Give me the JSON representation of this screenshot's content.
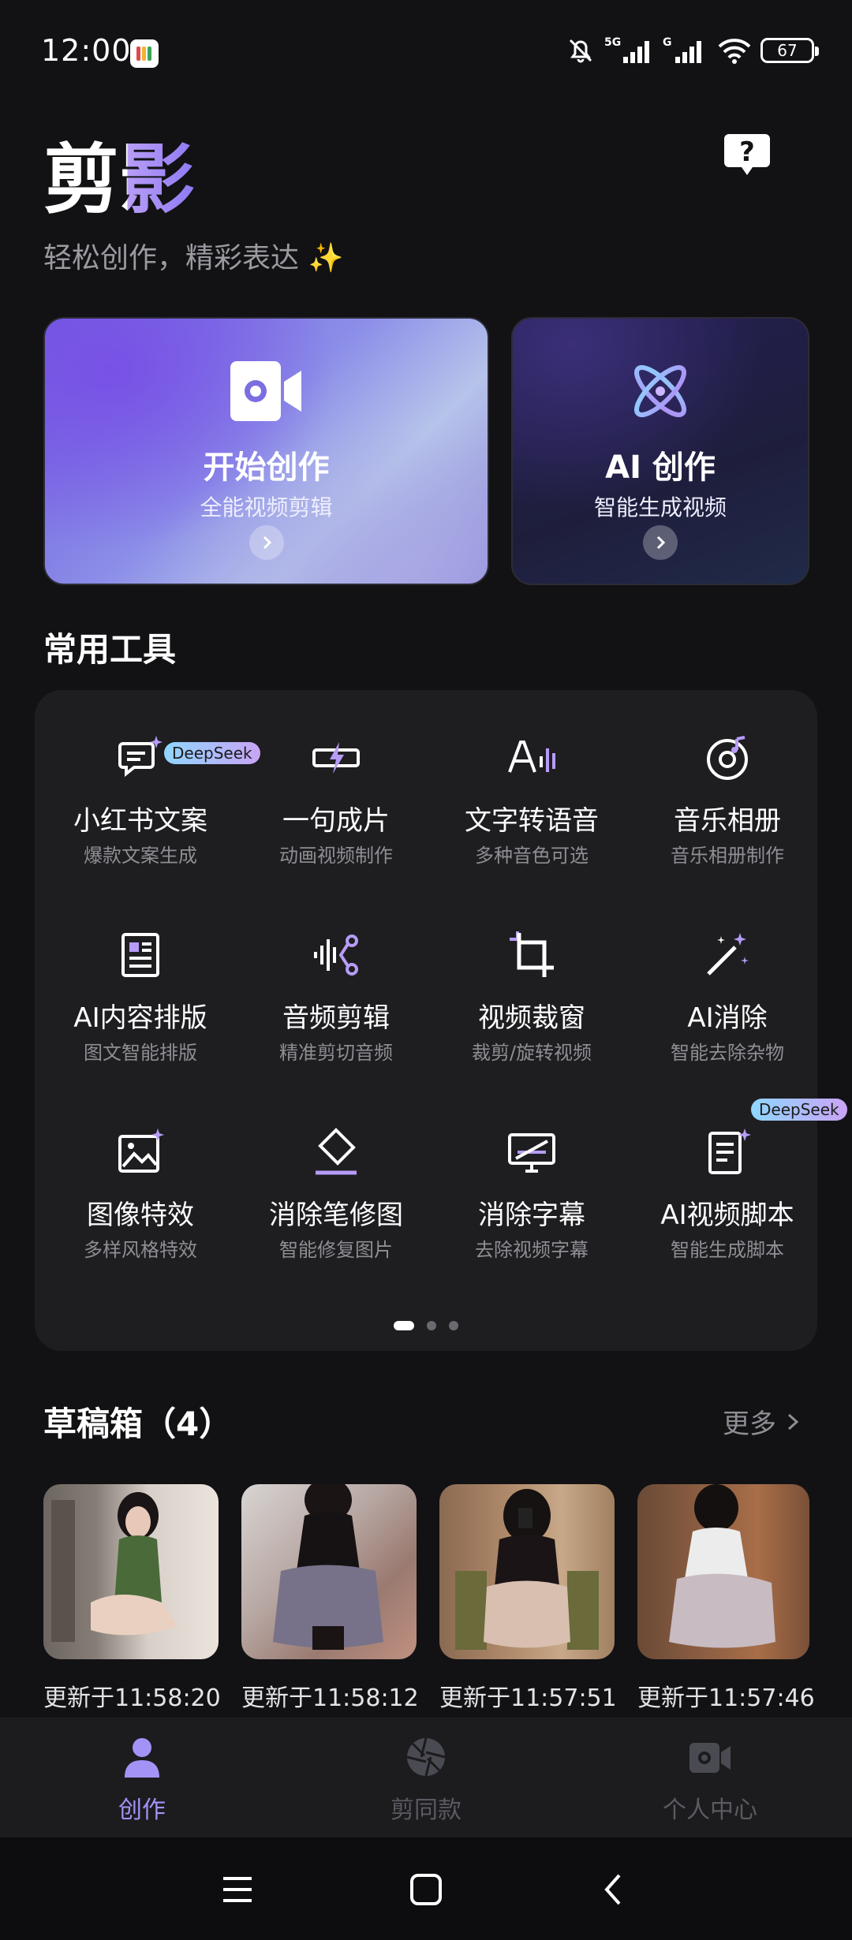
{
  "status_bar": {
    "time": "12:00",
    "battery": "67",
    "network": "5G"
  },
  "header": {
    "app_name": "剪影",
    "tagline": "轻松创作，精彩表达 ✨",
    "help_icon": "help-bubble-icon"
  },
  "hero": {
    "start": {
      "title": "开始创作",
      "subtitle": "全能视频剪辑",
      "icon": "video-camera-icon"
    },
    "ai": {
      "title": "AI 创作",
      "subtitle": "智能生成视频",
      "icon": "atom-icon"
    }
  },
  "tools_section": {
    "title": "常用工具",
    "items": [
      {
        "name": "小红书文案",
        "desc": "爆款文案生成",
        "icon": "chat-sparkle-icon",
        "badge": "DeepSeek"
      },
      {
        "name": "一句成片",
        "desc": "动画视频制作",
        "icon": "bolt-frame-icon"
      },
      {
        "name": "文字转语音",
        "desc": "多种音色可选",
        "icon": "text-to-speech-icon"
      },
      {
        "name": "音乐相册",
        "desc": "音乐相册制作",
        "icon": "music-disc-icon"
      },
      {
        "name": "AI内容排版",
        "desc": "图文智能排版",
        "icon": "layout-doc-icon"
      },
      {
        "name": "音频剪辑",
        "desc": "精准剪切音频",
        "icon": "audio-cut-icon"
      },
      {
        "name": "视频裁窗",
        "desc": "裁剪/旋转视频",
        "icon": "crop-icon"
      },
      {
        "name": "AI消除",
        "desc": "智能去除杂物",
        "icon": "magic-wand-icon"
      },
      {
        "name": "图像特效",
        "desc": "多样风格特效",
        "icon": "image-sparkle-icon"
      },
      {
        "name": "消除笔修图",
        "desc": "智能修复图片",
        "icon": "eraser-icon"
      },
      {
        "name": "消除字幕",
        "desc": "去除视频字幕",
        "icon": "subtitle-remove-icon"
      },
      {
        "name": "AI视频脚本",
        "desc": "智能生成脚本",
        "icon": "script-doc-icon",
        "badge": "DeepSeek"
      }
    ],
    "page_count": 3,
    "active_page": 1
  },
  "drafts": {
    "title": "草稿箱（4）",
    "more_label": "更多",
    "items": [
      {
        "updated": "更新于11:58:20"
      },
      {
        "updated": "更新于11:58:12"
      },
      {
        "updated": "更新于11:57:51"
      },
      {
        "updated": "更新于11:57:46"
      }
    ]
  },
  "tabbar": {
    "items": [
      {
        "label": "创作",
        "icon": "person-icon",
        "active": true
      },
      {
        "label": "剪同款",
        "icon": "aperture-icon",
        "active": false
      },
      {
        "label": "个人中心",
        "icon": "camera-icon",
        "active": false
      }
    ]
  },
  "colors": {
    "accent": "#9d8cf5",
    "background": "#121215",
    "panel": "#1e1e21",
    "muted_text": "#8e8e94"
  }
}
